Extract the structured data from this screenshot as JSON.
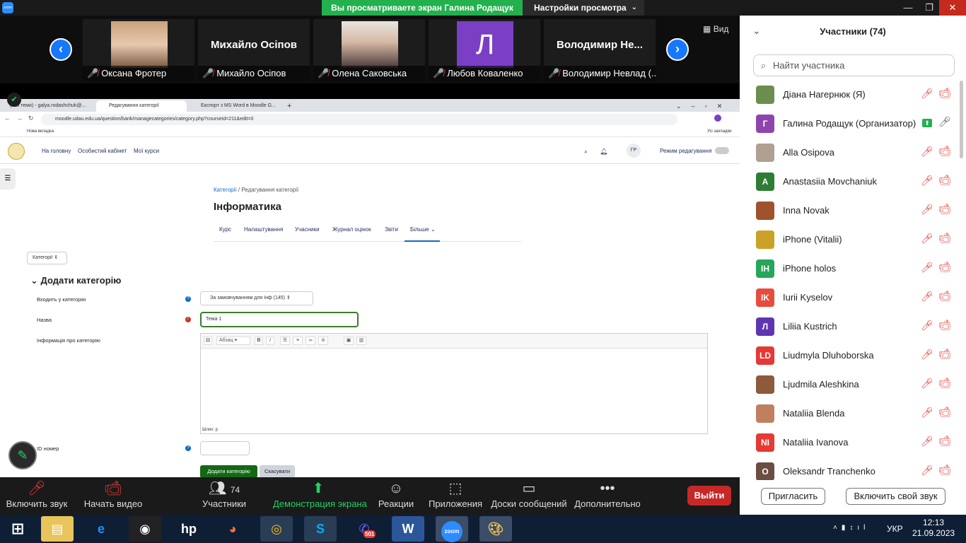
{
  "zoom": {
    "share_banner": "Вы просматриваете экран Галина Родащук",
    "view_settings": "Настройки просмотра",
    "view_btn": "Вид",
    "tiles": [
      {
        "caption": "Оксана Фротер",
        "big": ""
      },
      {
        "caption": "Михайло Осіпов",
        "big": "Михайло Осіпов"
      },
      {
        "caption": "Олена Саковська",
        "big": ""
      },
      {
        "caption": "Любов Коваленко",
        "big": "Л"
      },
      {
        "caption": "Володимир Невлад (...",
        "big": "Володимир Не..."
      }
    ],
    "toolbar": {
      "unmute": "Включить звук",
      "video": "Начать видео",
      "participants": "Участники",
      "participants_count": "74",
      "share": "Демонстрация экрана",
      "reactions": "Реакции",
      "apps": "Приложения",
      "boards": "Доски сообщений",
      "more": "Дополнительно",
      "leave": "Выйти"
    }
  },
  "browser": {
    "tabs": [
      "(без теми) - galya.rodashchuk@...",
      "Редагування категорії",
      "Експорт з MS Word в Moodle G..."
    ],
    "url": "moodle.udau.edu.ua/question/bank/managecategories/category.php?courseid=211&edit=0",
    "bookmark": "Нова вкладка",
    "all_bookmarks": "Усі закладки"
  },
  "moodle": {
    "nav": [
      "На головну",
      "Особистий кабінет",
      "Мої курси"
    ],
    "avatar": "ГР",
    "edit_mode": "Режим редагування",
    "breadcrumb": {
      "link": "Категорії",
      "sep": "/",
      "current": "Редагування категорії"
    },
    "course_title": "Інформатика",
    "sec_nav": [
      "Курс",
      "Налаштування",
      "Учасники",
      "Журнал оцінок",
      "Звіти",
      "Більше"
    ],
    "cat_select": "Категорії",
    "form_heading": "Додати категорію",
    "labels": {
      "parent": "Входить у категорію",
      "name": "Назва",
      "info": "Інформація про категорію",
      "idnumber": "ID номер"
    },
    "parent_value": "За замовчуванням для Інф (145)",
    "name_value": "Тема 1",
    "editor_format": "Абзац",
    "editor_path": "Шлях: p",
    "btn_add": "Додати категорію",
    "btn_cancel": "Скасувати"
  },
  "panel": {
    "title": "Участники (74)",
    "search_placeholder": "Найти участника",
    "participants": [
      {
        "name": "Діана Нагернюк (Я)",
        "initials": "",
        "color": "#6b8e4e"
      },
      {
        "name": "Галина Родащук (Организатор)",
        "initials": "Г",
        "color": "#8e44ad"
      },
      {
        "name": "Alla Osipova",
        "initials": "",
        "color": "#b0a090"
      },
      {
        "name": "Anastasiia Movchaniuk",
        "initials": "A",
        "color": "#2e7d32"
      },
      {
        "name": "Inna Novak",
        "initials": "",
        "color": "#a0522d"
      },
      {
        "name": "iPhone (Vitalii)",
        "initials": "",
        "color": "#c9a227"
      },
      {
        "name": "iPhone holos",
        "initials": "IH",
        "color": "#26a65b"
      },
      {
        "name": "Iurii Kyselov",
        "initials": "IK",
        "color": "#e74c3c"
      },
      {
        "name": "Liliia Kustrich",
        "initials": "Л",
        "color": "#5e35b1"
      },
      {
        "name": "Liudmyla Dluhoborska",
        "initials": "LD",
        "color": "#e53935"
      },
      {
        "name": "Ljudmila Aleshkina",
        "initials": "",
        "color": "#8d5a3b"
      },
      {
        "name": "Nataliia Blenda",
        "initials": "",
        "color": "#c08060"
      },
      {
        "name": "Nataliia Ivanova",
        "initials": "NI",
        "color": "#e53935"
      },
      {
        "name": "Oleksandr Tranchenko",
        "initials": "O",
        "color": "#6d4c41"
      }
    ],
    "invite": "Пригласить",
    "unmute": "Включить свой звук"
  },
  "taskbar": {
    "lang": "УКР",
    "time": "12:13",
    "date": "21.09.2023",
    "viber_badge": "501"
  }
}
